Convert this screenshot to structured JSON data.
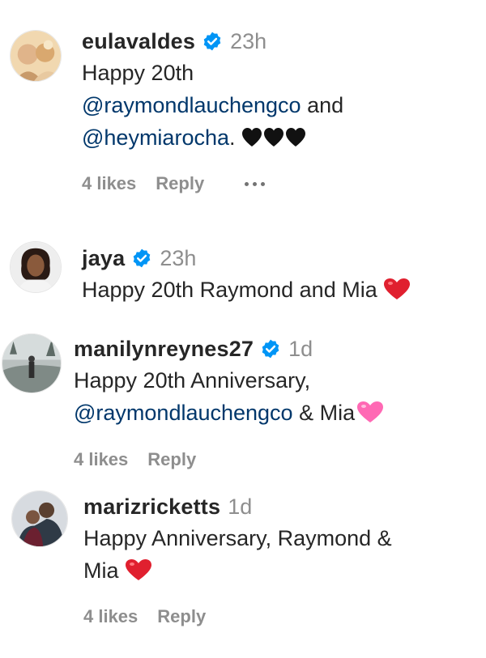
{
  "comments": [
    {
      "username": "eulavaldes",
      "verified": true,
      "time": "23h",
      "lines": [
        {
          "text": "Happy 20th"
        },
        {
          "mention": "@raymondlauchengco",
          "text": " and"
        },
        {
          "mention": "@heymiarocha",
          "text": ". "
        }
      ],
      "emoji": "black-hearts",
      "likes": "4 likes",
      "reply": "Reply"
    },
    {
      "username": "jaya",
      "verified": true,
      "time": "23h",
      "lines": [
        {
          "text": "Happy 20th Raymond and Mia "
        }
      ],
      "emoji": "red-heart"
    },
    {
      "username": "manilynreynes27",
      "verified": true,
      "time": "1d",
      "lines": [
        {
          "text": "Happy 20th Anniversary,"
        },
        {
          "mention": "@raymondlauchengco",
          "text": " & Mia"
        }
      ],
      "emoji": "pink-heart",
      "likes": "4 likes",
      "reply": "Reply"
    },
    {
      "username": "marizricketts",
      "verified": false,
      "time": "1d",
      "lines": [
        {
          "text": "Happy Anniversary, Raymond &"
        },
        {
          "text": "Mia "
        }
      ],
      "emoji": "red-heart",
      "likes": "4 likes",
      "reply": "Reply"
    }
  ],
  "icons": {
    "verified": "verified-badge-icon",
    "more": "more-options-icon"
  },
  "colors": {
    "text": "#262626",
    "muted": "#8e8e8e",
    "mention": "#00376b",
    "verified": "#0095f6",
    "red_heart": "#e0202f",
    "pink_heart": "#ff69b4",
    "black_heart": "#111111"
  }
}
